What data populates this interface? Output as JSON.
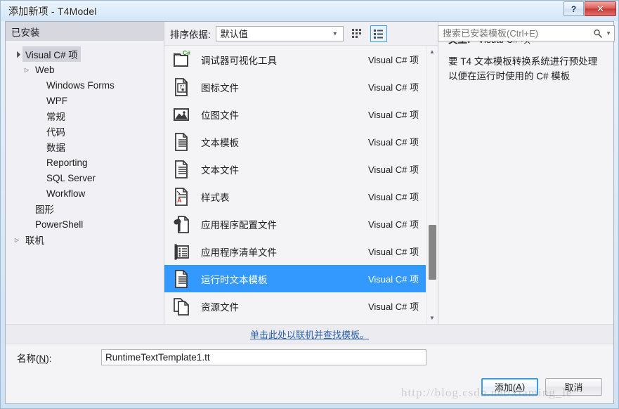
{
  "window": {
    "title": "添加新项 - T4Model",
    "help_label": "?",
    "close_label": "✕"
  },
  "left_pane": {
    "header": "已安装",
    "tree": [
      {
        "label": "Visual C# 项",
        "level": 0,
        "twisty": "▲",
        "selected": true
      },
      {
        "label": "Web",
        "level": 1,
        "twisty": "▶",
        "selected": false
      },
      {
        "label": "Windows Forms",
        "level": 2,
        "twisty": "",
        "selected": false
      },
      {
        "label": "WPF",
        "level": 2,
        "twisty": "",
        "selected": false
      },
      {
        "label": "常规",
        "level": 2,
        "twisty": "",
        "selected": false
      },
      {
        "label": "代码",
        "level": 2,
        "twisty": "",
        "selected": false
      },
      {
        "label": "数据",
        "level": 2,
        "twisty": "",
        "selected": false
      },
      {
        "label": "Reporting",
        "level": 2,
        "twisty": "",
        "selected": false
      },
      {
        "label": "SQL Server",
        "level": 2,
        "twisty": "",
        "selected": false
      },
      {
        "label": "Workflow",
        "level": 2,
        "twisty": "",
        "selected": false
      },
      {
        "label": "图形",
        "level": 1,
        "twisty": "",
        "selected": false
      },
      {
        "label": "PowerShell",
        "level": 1,
        "twisty": "",
        "selected": false
      },
      {
        "label": "联机",
        "level": 0,
        "twisty": "▶",
        "selected": false
      }
    ]
  },
  "toolbar": {
    "sort_label": "排序依据:",
    "sort_value": "默认值",
    "sort_arrow": "▼",
    "grid_view_title": "网格视图",
    "list_view_title": "列表视图"
  },
  "search": {
    "placeholder": "搜索已安装模板(Ctrl+E)",
    "value": ""
  },
  "templates": [
    {
      "name": "调试器可视化工具",
      "kind": "Visual C# 项",
      "icon": "csharp-folder-icon",
      "selected": false
    },
    {
      "name": "图标文件",
      "kind": "Visual C# 项",
      "icon": "icon-file-icon",
      "selected": false
    },
    {
      "name": "位图文件",
      "kind": "Visual C# 项",
      "icon": "bitmap-file-icon",
      "selected": false
    },
    {
      "name": "文本模板",
      "kind": "Visual C# 项",
      "icon": "text-doc-icon",
      "selected": false
    },
    {
      "name": "文本文件",
      "kind": "Visual C# 项",
      "icon": "text-doc-icon",
      "selected": false
    },
    {
      "name": "样式表",
      "kind": "Visual C# 项",
      "icon": "stylesheet-icon",
      "selected": false
    },
    {
      "name": "应用程序配置文件",
      "kind": "Visual C# 项",
      "icon": "config-file-icon",
      "selected": false
    },
    {
      "name": "应用程序清单文件",
      "kind": "Visual C# 项",
      "icon": "manifest-file-icon",
      "selected": false
    },
    {
      "name": "运行时文本模板",
      "kind": "Visual C# 项",
      "icon": "text-doc-icon",
      "selected": true
    },
    {
      "name": "资源文件",
      "kind": "Visual C# 项",
      "icon": "resource-file-icon",
      "selected": false
    }
  ],
  "right_pane": {
    "type_label": "类型:",
    "type_value": "Visual C# 项",
    "description": "要 T4 文本模板转换系统进行预处理以便在运行时使用的 C# 模板"
  },
  "online_link": "单击此处以联机并查找模板。",
  "name_field": {
    "label_prefix": "名称(",
    "label_key": "N",
    "label_suffix": "):",
    "value": "RuntimeTextTemplate1.tt"
  },
  "footer": {
    "add_prefix": "添加(",
    "add_key": "A",
    "add_suffix": ")",
    "cancel_label": "取消"
  },
  "watermark": "http://blog.csdn.net/xiaming_le",
  "colors": {
    "selection_blue": "#3399ff",
    "accent_border": "#3c9ae8",
    "link_blue": "#2b5faa",
    "close_red": "#c93b36"
  }
}
